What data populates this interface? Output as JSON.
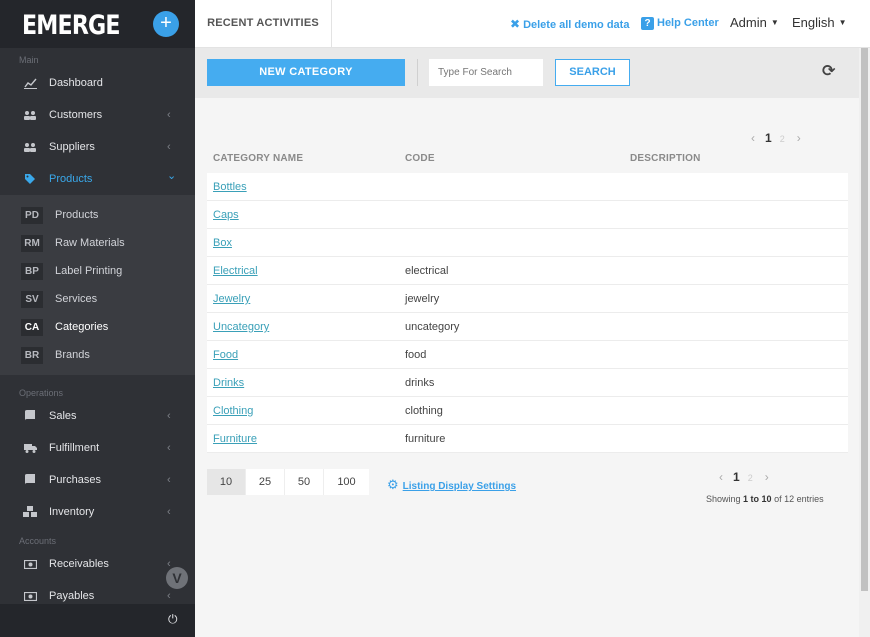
{
  "sidebar": {
    "logo": "EMERGE",
    "add_symbol": "+",
    "sections": {
      "main": "Main",
      "operations": "Operations",
      "accounts": "Accounts"
    },
    "main_items": [
      {
        "label": "Dashboard",
        "icon": "chart-line-icon",
        "glyph": "📈"
      },
      {
        "label": "Customers",
        "icon": "users-icon",
        "glyph": "👥",
        "chev": "‹"
      },
      {
        "label": "Suppliers",
        "icon": "users-icon",
        "glyph": "👥",
        "chev": "‹"
      },
      {
        "label": "Products",
        "icon": "tag-icon",
        "glyph": "🏷",
        "chev": "⌄"
      }
    ],
    "product_sub": [
      {
        "badge": "PD",
        "label": "Products"
      },
      {
        "badge": "RM",
        "label": "Raw Materials"
      },
      {
        "badge": "BP",
        "label": "Label Printing"
      },
      {
        "badge": "SV",
        "label": "Services"
      },
      {
        "badge": "CA",
        "label": "Categories"
      },
      {
        "badge": "BR",
        "label": "Brands"
      }
    ],
    "ops_items": [
      {
        "label": "Sales",
        "chev": "‹"
      },
      {
        "label": "Fulfillment",
        "chev": "‹"
      },
      {
        "label": "Purchases",
        "chev": "‹"
      },
      {
        "label": "Inventory",
        "chev": "‹"
      }
    ],
    "acc_items": [
      {
        "label": "Receivables",
        "chev": "‹"
      },
      {
        "label": "Payables",
        "chev": "‹"
      }
    ],
    "scroll_badge": "V",
    "power_glyph": "⏻"
  },
  "topbar": {
    "tab": "RECENT ACTIVITIES",
    "delete_demo": "Delete all demo data",
    "delete_glyph": "✖",
    "help": "Help Center",
    "help_glyph": "?",
    "user": "Admin",
    "language": "English",
    "caret": "▼"
  },
  "toolbar": {
    "new_category": "NEW CATEGORY",
    "search_placeholder": "Type For Search",
    "search": "SEARCH",
    "refresh_glyph": "⟳"
  },
  "table": {
    "columns": [
      "CATEGORY NAME",
      "CODE",
      "DESCRIPTION"
    ],
    "rows": [
      {
        "name": "Bottles",
        "code": ""
      },
      {
        "name": "Caps",
        "code": ""
      },
      {
        "name": "Box",
        "code": ""
      },
      {
        "name": "Electrical",
        "code": "electrical"
      },
      {
        "name": "Jewelry",
        "code": "jewelry"
      },
      {
        "name": "Uncategory",
        "code": "uncategory"
      },
      {
        "name": "Food",
        "code": "food"
      },
      {
        "name": "Drinks",
        "code": "drinks"
      },
      {
        "name": "Clothing",
        "code": "clothing"
      },
      {
        "name": "Furniture",
        "code": "furniture"
      }
    ]
  },
  "pagination": {
    "prev": "‹",
    "next": "›",
    "current": "1",
    "other": "2",
    "page_sizes": [
      "10",
      "25",
      "50",
      "100"
    ],
    "selected_size": "10",
    "listing_settings": "Listing Display Settings",
    "gear_glyph": "⚙",
    "showing_prefix": "Showing",
    "showing_range": "1 to 10",
    "showing_suffix": "of 12 entries"
  }
}
